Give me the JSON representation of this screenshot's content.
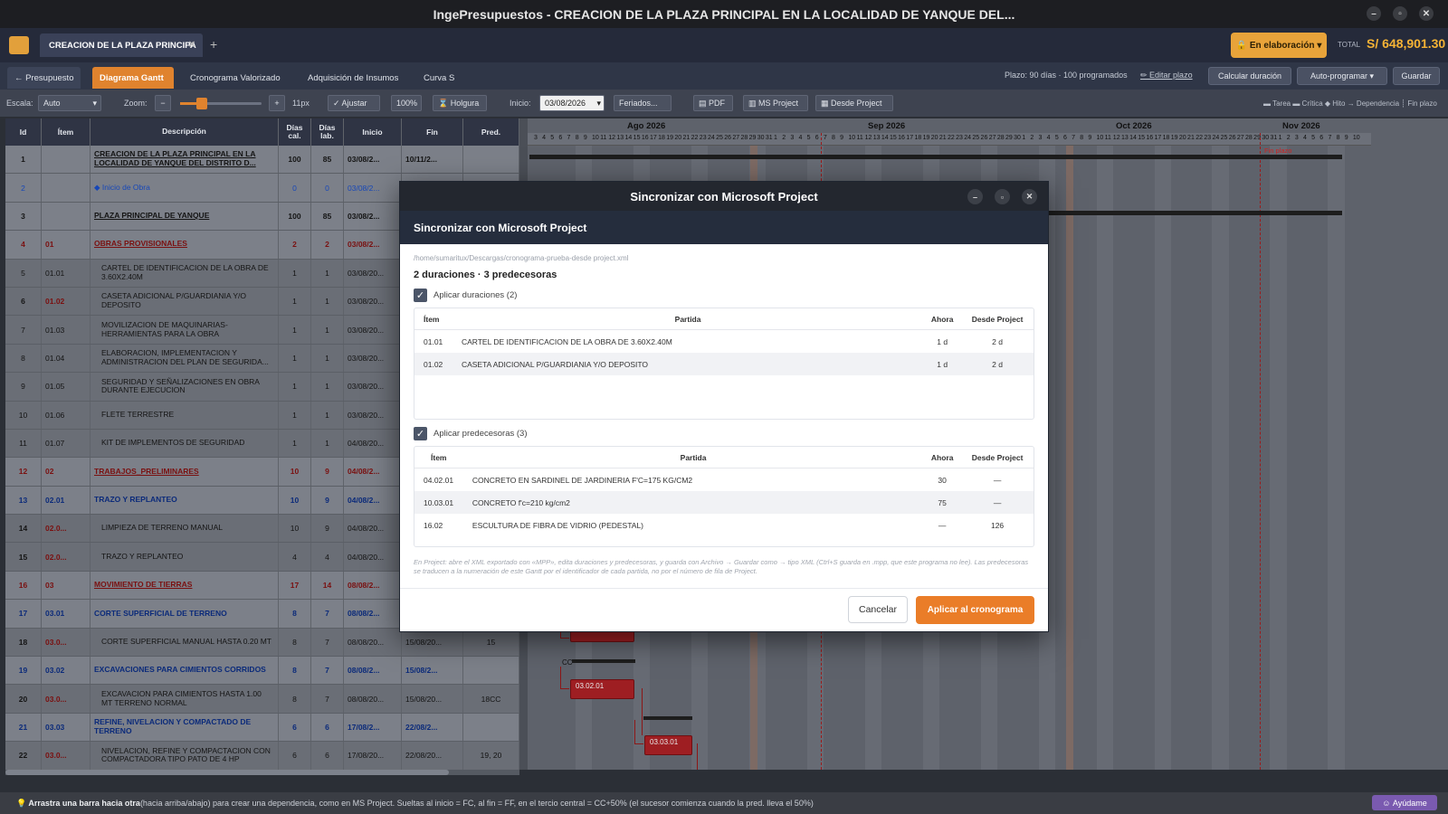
{
  "window": {
    "title": "IngePresupuestos  -  CREACION DE LA PLAZA PRINCIPAL EN LA LOCALIDAD DE YANQUE DEL..."
  },
  "tabbar": {
    "doc_tab": "CREACION DE LA PLAZA PRINCIPA",
    "status": "En elaboración",
    "total_label": "TOTAL",
    "total_value": "S/ 648,901.30"
  },
  "views": {
    "back": "← Presupuesto",
    "tabs": [
      "Diagrama Gantt",
      "Cronograma Valorizado",
      "Adquisición de Insumos",
      "Curva S"
    ],
    "plazo": "Plazo: 90 días · 100 programados",
    "edit_plazo": "✏ Editar plazo",
    "calc": "Calcular duración",
    "auto": "Auto-programar ▾",
    "save": "Guardar"
  },
  "toolbar": {
    "escala_label": "Escala:",
    "escala_value": "Auto",
    "zoom_label": "Zoom:",
    "zoom_px": "11px",
    "ajustar": "✓ Ajustar",
    "pct": "100%",
    "holgura": "⌛ Holgura",
    "inicio_label": "Inicio:",
    "inicio_value": "03/08/2026",
    "feriados": "Feriados...",
    "pdf": "PDF",
    "msproject": "MS Project",
    "desde": "Desde Project",
    "legend": "▬ Tarea ▬ Crítica ◆ Hito → Dependencia ┊ Fin plazo"
  },
  "grid": {
    "headers": {
      "id": "Id",
      "item": "Ítem",
      "desc": "Descripción",
      "dc": "Días cal.",
      "dl": "Días lab.",
      "ini": "Inicio",
      "fin": "Fin",
      "pred": "Pred."
    },
    "rows": [
      {
        "id": "1",
        "item": "",
        "desc": "CREACION DE LA PLAZA PRINCIPAL EN LA LOCALIDAD DE YANQUE DEL DISTRITO D...",
        "dc": "100",
        "dl": "85",
        "ini": "03/08/2...",
        "fin": "10/11/2...",
        "pred": "",
        "style": "root"
      },
      {
        "id": "2",
        "item": "",
        "desc": "◆ Inicio de Obra",
        "dc": "0",
        "dl": "0",
        "ini": "03/08/2...",
        "fin": "",
        "pred": "",
        "style": "milestone"
      },
      {
        "id": "3",
        "item": "",
        "desc": "PLAZA PRINCIPAL DE YANQUE",
        "dc": "100",
        "dl": "85",
        "ini": "03/08/2...",
        "fin": "",
        "pred": "",
        "style": "root"
      },
      {
        "id": "4",
        "item": "01",
        "desc": "OBRAS PROVISIONALES",
        "dc": "2",
        "dl": "2",
        "ini": "03/08/2...",
        "fin": "",
        "pred": "",
        "style": "red"
      },
      {
        "id": "5",
        "item": "01.01",
        "desc": "CARTEL DE IDENTIFICACION DE LA OBRA DE 3.60X2.40M",
        "dc": "1",
        "dl": "1",
        "ini": "03/08/20...",
        "fin": "",
        "pred": "",
        "style": "normal"
      },
      {
        "id": "6",
        "item": "01.02",
        "desc": "CASETA ADICIONAL P/GUARDIANIA Y/O DEPOSITO",
        "dc": "1",
        "dl": "1",
        "ini": "03/08/20...",
        "fin": "",
        "pred": "",
        "style": "critical"
      },
      {
        "id": "7",
        "item": "01.03",
        "desc": "MOVILIZACION DE MAQUINARIAS-HERRAMIENTAS PARA LA OBRA",
        "dc": "1",
        "dl": "1",
        "ini": "03/08/20...",
        "fin": "",
        "pred": "",
        "style": "normal"
      },
      {
        "id": "8",
        "item": "01.04",
        "desc": "ELABORACION, IMPLEMENTACION Y ADMINISTRACION DEL PLAN DE SEGURIDA...",
        "dc": "1",
        "dl": "1",
        "ini": "03/08/20...",
        "fin": "",
        "pred": "",
        "style": "normal"
      },
      {
        "id": "9",
        "item": "01.05",
        "desc": "SEGURIDAD Y SEÑALIZACIONES EN OBRA DURANTE EJECUCION",
        "dc": "1",
        "dl": "1",
        "ini": "03/08/20...",
        "fin": "",
        "pred": "",
        "style": "normal"
      },
      {
        "id": "10",
        "item": "01.06",
        "desc": "FLETE TERRESTRE",
        "dc": "1",
        "dl": "1",
        "ini": "03/08/20...",
        "fin": "",
        "pred": "",
        "style": "normal"
      },
      {
        "id": "11",
        "item": "01.07",
        "desc": "KIT DE IMPLEMENTOS DE SEGURIDAD",
        "dc": "1",
        "dl": "1",
        "ini": "04/08/20...",
        "fin": "",
        "pred": "",
        "style": "normal"
      },
      {
        "id": "12",
        "item": "02",
        "desc": "TRABAJOS_PRELIMINARES",
        "dc": "10",
        "dl": "9",
        "ini": "04/08/2...",
        "fin": "",
        "pred": "",
        "style": "red"
      },
      {
        "id": "13",
        "item": "02.01",
        "desc": "TRAZO Y REPLANTEO",
        "dc": "10",
        "dl": "9",
        "ini": "04/08/2...",
        "fin": "",
        "pred": "",
        "style": "blue"
      },
      {
        "id": "14",
        "item": "02.0...",
        "desc": "LIMPIEZA DE TERRENO MANUAL",
        "dc": "10",
        "dl": "9",
        "ini": "04/08/20...",
        "fin": "",
        "pred": "",
        "style": "critical"
      },
      {
        "id": "15",
        "item": "02.0...",
        "desc": "TRAZO Y REPLANTEO",
        "dc": "4",
        "dl": "4",
        "ini": "04/08/20...",
        "fin": "",
        "pred": "",
        "style": "critical"
      },
      {
        "id": "16",
        "item": "03",
        "desc": "MOVIMIENTO DE TIERRAS",
        "dc": "17",
        "dl": "14",
        "ini": "08/08/2...",
        "fin": "",
        "pred": "",
        "style": "red"
      },
      {
        "id": "17",
        "item": "03.01",
        "desc": "CORTE SUPERFICIAL DE TERRENO",
        "dc": "8",
        "dl": "7",
        "ini": "08/08/2...",
        "fin": "",
        "pred": "",
        "style": "blue"
      },
      {
        "id": "18",
        "item": "03.0...",
        "desc": "CORTE SUPERFICIAL MANUAL HASTA 0.20 MT",
        "dc": "8",
        "dl": "7",
        "ini": "08/08/20...",
        "fin": "15/08/20...",
        "pred": "15",
        "style": "critical"
      },
      {
        "id": "19",
        "item": "03.02",
        "desc": "EXCAVACIONES PARA CIMIENTOS CORRIDOS",
        "dc": "8",
        "dl": "7",
        "ini": "08/08/2...",
        "fin": "15/08/2...",
        "pred": "",
        "style": "blue"
      },
      {
        "id": "20",
        "item": "03.0...",
        "desc": "EXCAVACION PARA CIMIENTOS HASTA 1.00 MT TERRENO NORMAL",
        "dc": "8",
        "dl": "7",
        "ini": "08/08/20...",
        "fin": "15/08/20...",
        "pred": "18CC",
        "style": "critical"
      },
      {
        "id": "21",
        "item": "03.03",
        "desc": "REFINE, NIVELACION Y COMPACTADO DE TERRENO",
        "dc": "6",
        "dl": "6",
        "ini": "17/08/2...",
        "fin": "22/08/2...",
        "pred": "",
        "style": "blue"
      },
      {
        "id": "22",
        "item": "03.0...",
        "desc": "NIVELACION, REFINE Y COMPACTACION CON COMPACTADORA TIPO PATO DE 4 HP",
        "dc": "6",
        "dl": "6",
        "ini": "17/08/20...",
        "fin": "22/08/20...",
        "pred": "19, 20",
        "style": "critical"
      }
    ]
  },
  "gantt": {
    "months": [
      "Ago 2026",
      "Sep 2026",
      "Oct 2026",
      "Nov 2026"
    ],
    "days": [
      "3",
      "4",
      "5",
      "6",
      "7",
      "8",
      "9",
      "10",
      "11",
      "12",
      "13",
      "14",
      "15",
      "16",
      "17",
      "18",
      "19",
      "20",
      "21",
      "22",
      "23",
      "24",
      "25",
      "26",
      "27",
      "28",
      "29",
      "30",
      "31",
      "1",
      "2",
      "3",
      "4",
      "5",
      "6",
      "7",
      "8",
      "9",
      "10",
      "11",
      "12",
      "13",
      "14",
      "15",
      "16",
      "17",
      "18",
      "19",
      "20",
      "21",
      "22",
      "23",
      "24",
      "25",
      "26",
      "27",
      "28",
      "29",
      "30",
      "1",
      "2",
      "3",
      "4",
      "5",
      "6",
      "7",
      "8",
      "9",
      "10",
      "11",
      "12",
      "13",
      "14",
      "15",
      "16",
      "17",
      "18",
      "19",
      "20",
      "21",
      "22",
      "23",
      "24",
      "25",
      "26",
      "27",
      "28",
      "29",
      "30",
      "31",
      "1",
      "2",
      "3",
      "4",
      "5",
      "6",
      "7",
      "8",
      "9",
      "10"
    ],
    "fin_plazo": "Fin plazo",
    "bars": [
      "03.01.01",
      "CC",
      "03.02.01",
      "03.03.01"
    ]
  },
  "dialog": {
    "window_title": "Sincronizar con Microsoft Project",
    "header": "Sincronizar con Microsoft Project",
    "path": "/home/sumaritux/Descargas/cronograma-prueba-desde project.xml",
    "summary": "2 duraciones · 3 predecesoras",
    "dur_check": "Aplicar duraciones (2)",
    "dur_headers": {
      "item": "Ítem",
      "partida": "Partida",
      "ahora": "Ahora",
      "desde": "Desde Project"
    },
    "dur_rows": [
      {
        "item": "01.01",
        "partida": "CARTEL DE IDENTIFICACION DE LA OBRA DE 3.60X2.40M",
        "ahora": "1 d",
        "desde": "2 d"
      },
      {
        "item": "01.02",
        "partida": "CASETA ADICIONAL P/GUARDIANIA Y/O DEPOSITO",
        "ahora": "1 d",
        "desde": "2 d"
      }
    ],
    "pred_check": "Aplicar predecesoras (3)",
    "pred_headers": {
      "item": "Ítem",
      "partida": "Partida",
      "ahora": "Ahora",
      "desde": "Desde Project"
    },
    "pred_rows": [
      {
        "item": "04.02.01",
        "partida": "CONCRETO EN SARDINEL DE JARDINERIA F'C=175 KG/CM2",
        "ahora": "30",
        "desde": "—"
      },
      {
        "item": "10.03.01",
        "partida": "CONCRETO f'c=210 kg/cm2",
        "ahora": "75",
        "desde": "—"
      },
      {
        "item": "16.02",
        "partida": "ESCULTURA DE FIBRA DE VIDRIO (PEDESTAL)",
        "ahora": "—",
        "desde": "126"
      }
    ],
    "note": "En Project: abre el XML exportado con «MPP», edita duraciones y predecesoras, y guarda con Archivo → Guardar como → tipo XML (Ctrl+S guarda en .mpp, que este programa no lee). Las predecesoras se traducen a la numeración de este Gantt por el identificador de cada partida, no por el número de fila de Project.",
    "cancel": "Cancelar",
    "apply": "Aplicar al cronograma"
  },
  "statusbar": {
    "hint_bold": "💡 Arrastra una barra hacia otra",
    "hint_rest": " (hacia arriba/abajo) para crear una dependencia, como en MS Project. Sueltas al inicio = FC, al fin = FF, en el tercio central = CC+50% (el sucesor comienza cuando la pred. lleva el 50%)",
    "help": "Ayúdame"
  }
}
